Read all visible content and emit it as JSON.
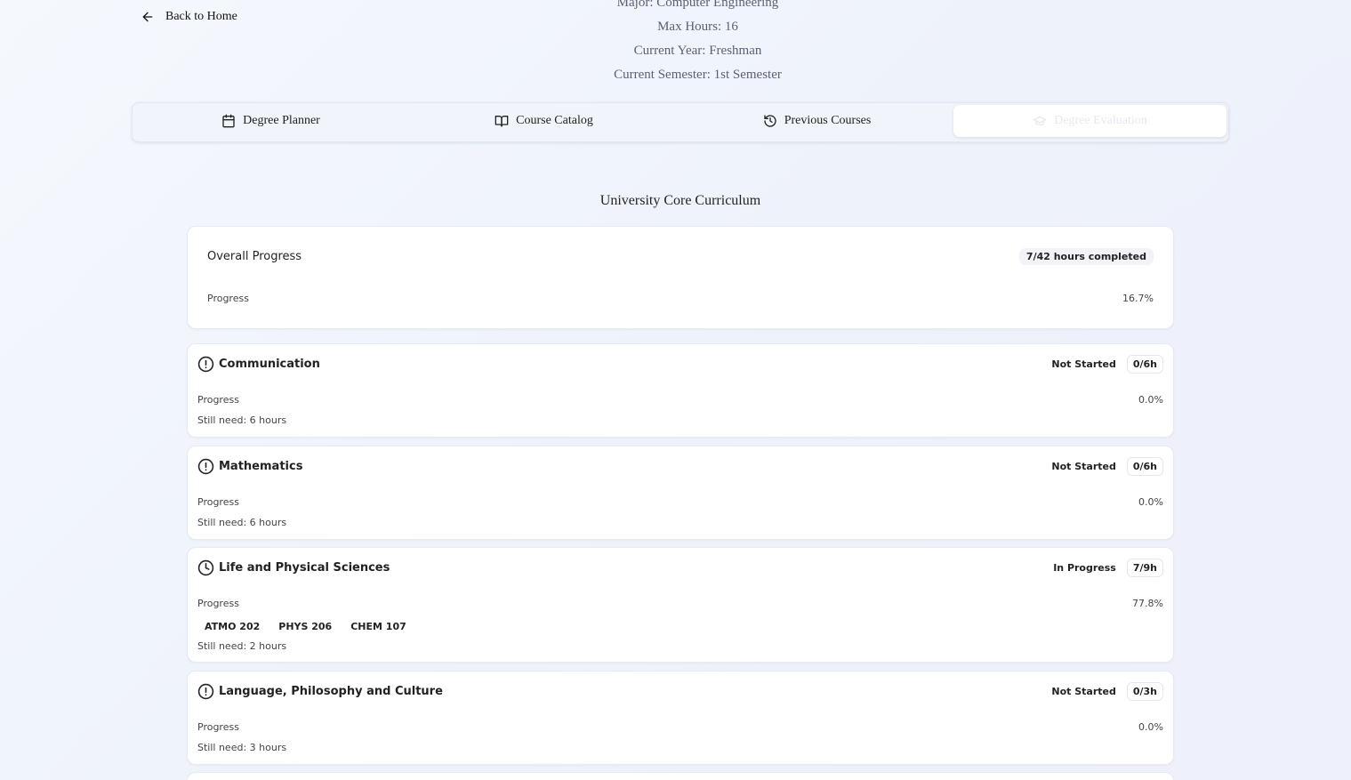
{
  "nav": {
    "back_label": "Back to Home"
  },
  "student": {
    "major": "Major: Computer Engineering",
    "max_hours": "Max Hours: 16",
    "current_year": "Current Year: Freshman",
    "current_semester": "Current Semester: 1st Semester"
  },
  "tabs": [
    {
      "label": "Degree Planner",
      "icon": "calendar-icon",
      "active": false
    },
    {
      "label": "Course Catalog",
      "icon": "book-icon",
      "active": false
    },
    {
      "label": "Previous Courses",
      "icon": "history-icon",
      "active": false
    },
    {
      "label": "Degree Evaluation",
      "icon": "graduation-cap-icon",
      "active": true
    }
  ],
  "section_title": "University Core Curriculum",
  "overall": {
    "title": "Overall Progress",
    "badge": "7/42 hours completed",
    "progress_label": "Progress",
    "progress_value": "16.7%"
  },
  "categories": [
    {
      "name": "Communication",
      "icon": "alert-circle-icon",
      "status": "Not Started",
      "hours": "0/6h",
      "progress_label": "Progress",
      "progress_value": "0.0%",
      "courses": [],
      "still_need": "Still need: 6 hours"
    },
    {
      "name": "Mathematics",
      "icon": "alert-circle-icon",
      "status": "Not Started",
      "hours": "0/6h",
      "progress_label": "Progress",
      "progress_value": "0.0%",
      "courses": [],
      "still_need": "Still need: 6 hours"
    },
    {
      "name": "Life and Physical Sciences",
      "icon": "clock-icon",
      "status": "In Progress",
      "hours": "7/9h",
      "progress_label": "Progress",
      "progress_value": "77.8%",
      "courses": [
        "ATMO 202",
        "PHYS 206",
        "CHEM 107"
      ],
      "still_need": "Still need: 2 hours"
    },
    {
      "name": "Language, Philosophy and Culture",
      "icon": "alert-circle-icon",
      "status": "Not Started",
      "hours": "0/3h",
      "progress_label": "Progress",
      "progress_value": "0.0%",
      "courses": [],
      "still_need": "Still need: 3 hours"
    }
  ]
}
